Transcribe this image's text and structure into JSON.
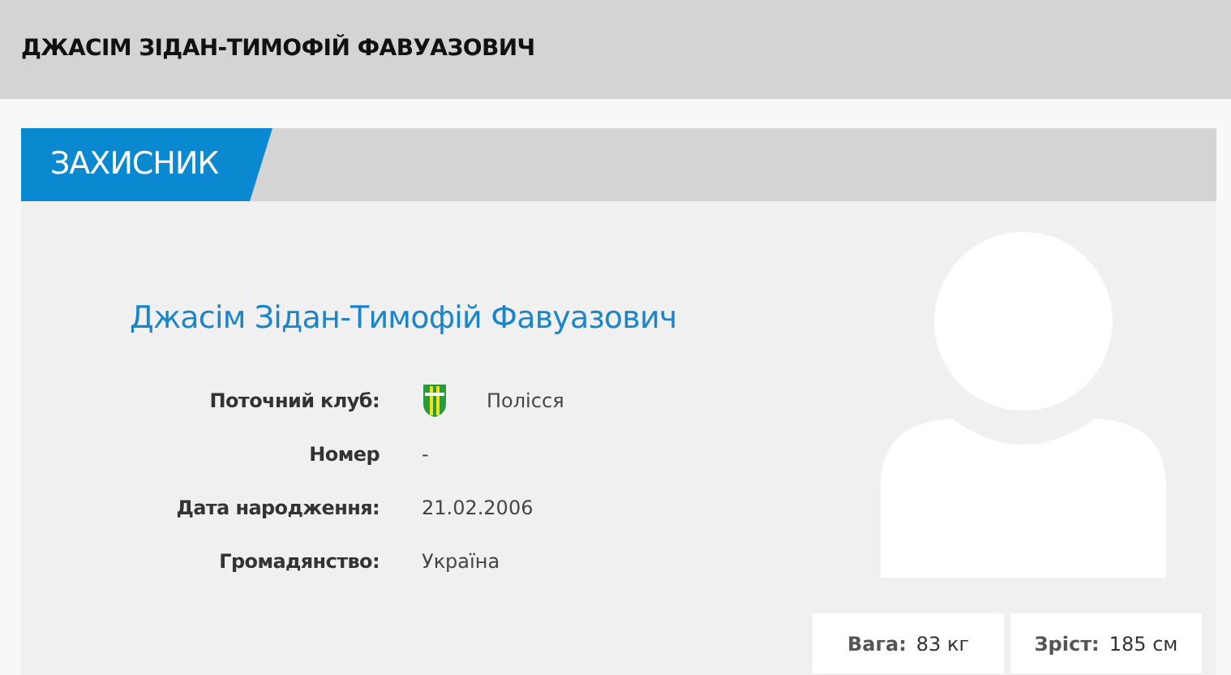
{
  "page_title": "ДЖАСІМ ЗІДАН-ТИМОФІЙ ФАВУАЗОВИЧ",
  "position_tab": "ЗАХИСНИК",
  "player_name": "Джасім Зідан-Тимофій Фавуазович",
  "details": [
    {
      "kind": "club",
      "label": "Поточний клуб:",
      "value": "Полісся"
    },
    {
      "kind": "text",
      "label": "Номер",
      "value": "-"
    },
    {
      "kind": "text",
      "label": "Дата народження:",
      "value": "21.02.2006"
    },
    {
      "kind": "text",
      "label": "Громадянство:",
      "value": "Україна"
    }
  ],
  "stats": [
    {
      "label": "Вага:",
      "value": "83 кг"
    },
    {
      "label": "Зріст:",
      "value": "185 см"
    }
  ]
}
